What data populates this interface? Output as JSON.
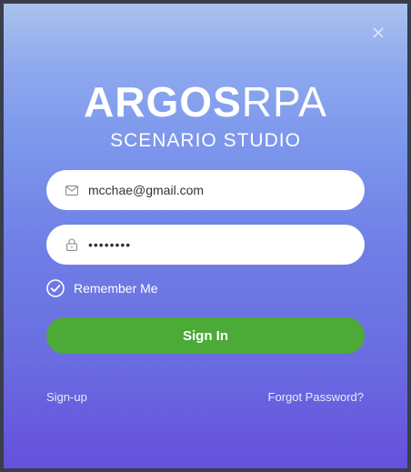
{
  "app": {
    "logo_bold": "ARGOS",
    "logo_light": "RPA",
    "subtitle": "SCENARIO STUDIO"
  },
  "form": {
    "email_value": "mcchae@gmail.com",
    "password_value": "••••••••",
    "remember_label": "Remember Me",
    "remember_checked": true,
    "signin_label": "Sign In"
  },
  "links": {
    "signup": "Sign-up",
    "forgot": "Forgot Password?"
  },
  "colors": {
    "gradient_top": "#a9c2ee",
    "gradient_bottom": "#6650dc",
    "signin_button": "#4caa36",
    "field_bg": "#ffffff",
    "window_border": "#3a3d4a"
  },
  "icons": {
    "close": "close-icon",
    "email": "mail-icon",
    "password": "lock-icon",
    "remember": "check-circle-icon"
  }
}
